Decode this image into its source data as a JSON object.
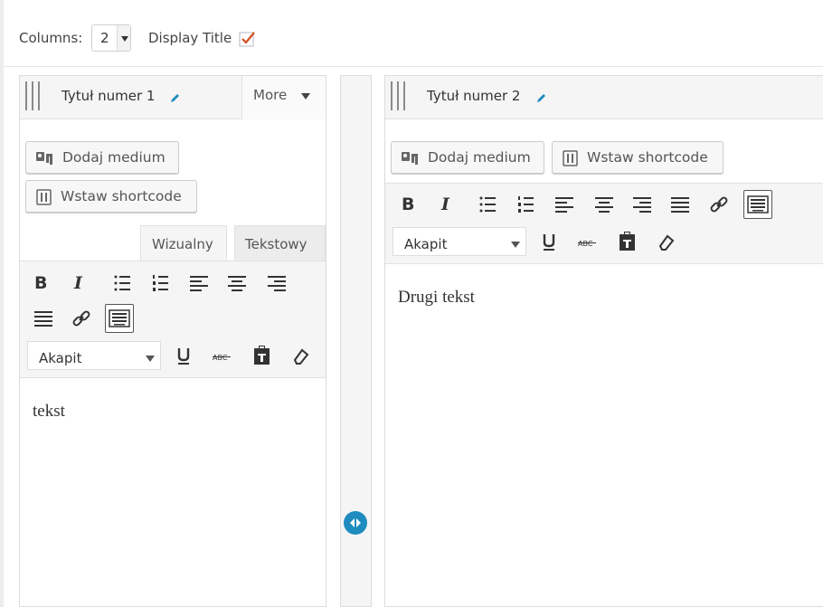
{
  "settings": {
    "columns_label": "Columns:",
    "columns_value": "2",
    "display_title_label": "Display Title",
    "display_title_checked": true,
    "check_color": "#d54e21"
  },
  "left_panel": {
    "title": "Tytuł numer 1",
    "more_label": "More",
    "buttons": {
      "add_media": "Dodaj medium",
      "insert_shortcode": "Wstaw shortcode"
    },
    "tabs": {
      "visual": "Wizualny",
      "text": "Tekstowy",
      "active": "visual"
    },
    "format_select": "Akapit",
    "content": "tekst"
  },
  "right_panel": {
    "title": "Tytuł numer 2",
    "buttons": {
      "add_media": "Dodaj medium",
      "insert_shortcode": "Wstaw shortcode"
    },
    "format_select": "Akapit",
    "content": "Drugi tekst"
  },
  "toolbar_icons": [
    "bold-icon",
    "italic-icon",
    "bullet-list-icon",
    "numbered-list-icon",
    "align-left-icon",
    "align-center-icon",
    "align-right-icon",
    "align-justify-icon",
    "link-icon",
    "keyboard-icon",
    "underline-icon",
    "strikethrough-icon",
    "paste-text-icon",
    "clear-formatting-icon"
  ],
  "colors": {
    "accent": "#1e8cbe",
    "pencil": "#1e8cbe",
    "toolbar_bg": "#f5f5f5"
  }
}
